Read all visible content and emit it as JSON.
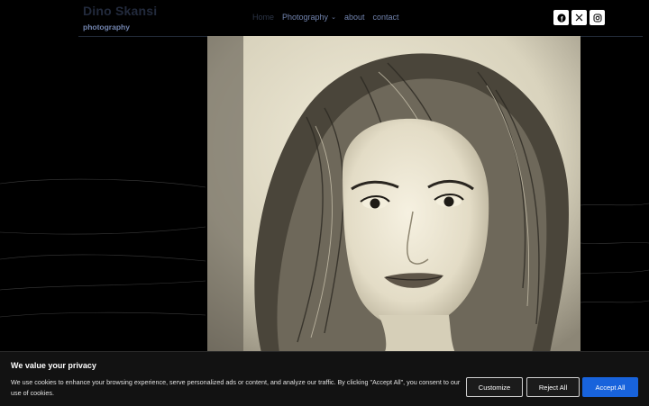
{
  "site": {
    "title": "Dino Skansi",
    "subtitle": "photography"
  },
  "nav": {
    "items": [
      {
        "label": "Home",
        "active": true,
        "has_dropdown": false
      },
      {
        "label": "Photography",
        "active": false,
        "has_dropdown": true
      },
      {
        "label": "about",
        "active": false,
        "has_dropdown": false
      },
      {
        "label": "contact",
        "active": false,
        "has_dropdown": false
      }
    ],
    "dropdown_icon": "chevron-down-icon"
  },
  "social": {
    "icons": [
      "facebook-icon",
      "x-twitter-icon",
      "instagram-icon"
    ]
  },
  "photo": {
    "style": "sepia black-and-white portrait of a woman with long wavy hair"
  },
  "cookie_banner": {
    "title": "We value your privacy",
    "text": "We use cookies to enhance your browsing experience, serve personalized ads or content, and analyze our traffic. By clicking \"Accept All\", you consent to our use of cookies.",
    "customize_label": "Customize",
    "reject_label": "Reject All",
    "accept_label": "Accept All"
  },
  "colors": {
    "background": "#000000",
    "nav_link": "#7183ad",
    "nav_active": "#2c3547",
    "accent": "#1863dc",
    "banner_bg": "#121212",
    "photo_tone": "#e6e1cc"
  }
}
